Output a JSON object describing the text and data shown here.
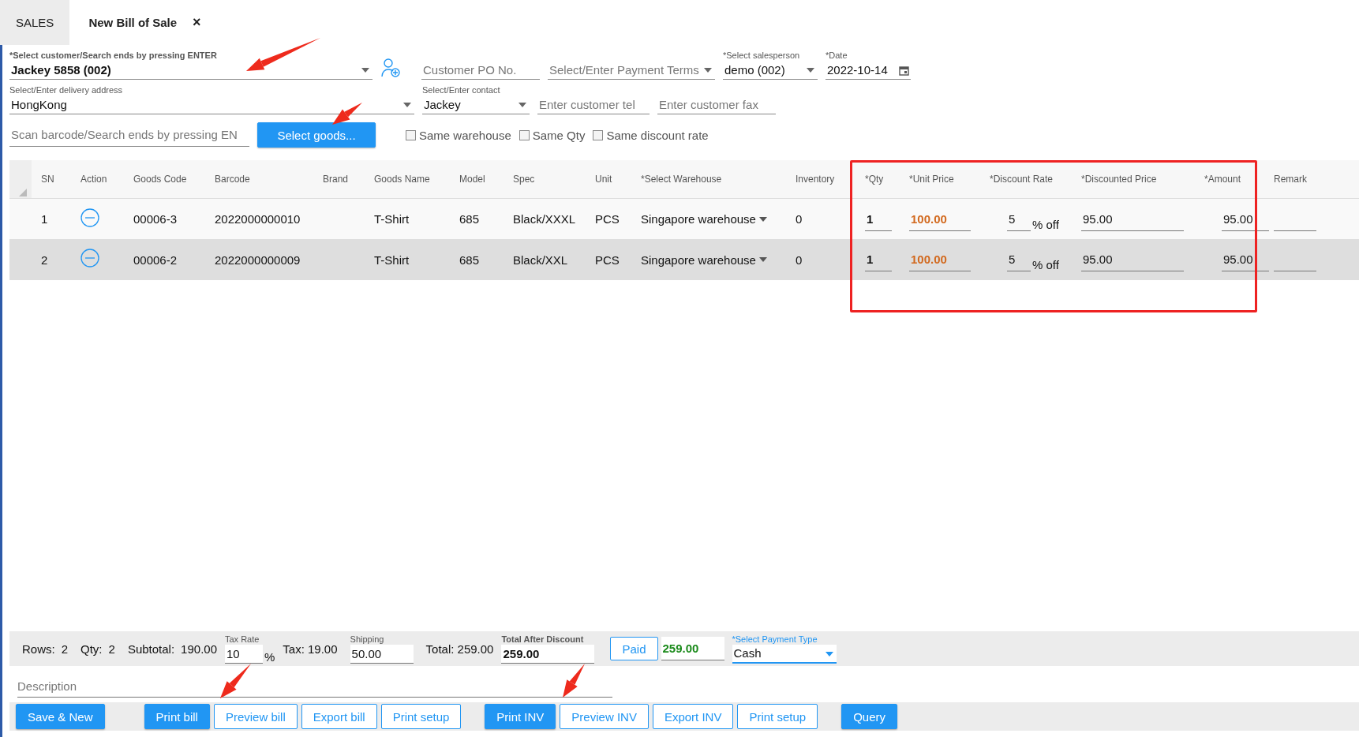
{
  "tabs": [
    {
      "label": "SALES",
      "selected": false
    },
    {
      "label": "New Bill of Sale",
      "selected": true,
      "close": "×"
    }
  ],
  "header": {
    "customer": {
      "label": "*Select customer/Search ends by pressing ENTER",
      "value": "Jackey 5858 (002)"
    },
    "po": {
      "placeholder": "Customer PO No."
    },
    "payment_terms": {
      "placeholder": "Select/Enter Payment Terms"
    },
    "salesperson": {
      "label": "*Select salesperson",
      "value": "demo (002)"
    },
    "date": {
      "label": "*Date",
      "value": "2022-10-14"
    },
    "delivery": {
      "label": "Select/Enter delivery address",
      "value": "HongKong"
    },
    "contact": {
      "label": "Select/Enter contact",
      "value": "Jackey"
    },
    "tel": {
      "placeholder": "Enter customer tel"
    },
    "fax": {
      "placeholder": "Enter customer fax"
    },
    "scan": {
      "placeholder": "Scan barcode/Search ends by pressing EN"
    },
    "select_goods": "Select goods...",
    "options": [
      {
        "label": "Same warehouse",
        "checked": false
      },
      {
        "label": "Same Qty",
        "checked": false
      },
      {
        "label": "Same discount rate",
        "checked": false
      }
    ]
  },
  "table": {
    "columns": [
      "SN",
      "Action",
      "Goods Code",
      "Barcode",
      "Brand",
      "Goods Name",
      "Model",
      "Spec",
      "Unit",
      "*Select Warehouse",
      "Inventory",
      "*Qty",
      "*Unit Price",
      "*Discount Rate",
      "*Discounted Price",
      "*Amount",
      "Remark"
    ],
    "rows": [
      {
        "sn": "1",
        "code": "00006-3",
        "barcode": "2022000000010",
        "name": "T-Shirt",
        "model": "685",
        "spec": "Black/XXXL",
        "unit": "PCS",
        "warehouse": "Singapore warehouse",
        "inventory": "0",
        "qty": "1",
        "unit_price": "100.00",
        "discount": "5",
        "discount_suffix": "% off",
        "discounted_price": "95.00",
        "amount": "95.00",
        "selected": false
      },
      {
        "sn": "2",
        "code": "00006-2",
        "barcode": "2022000000009",
        "name": "T-Shirt",
        "model": "685",
        "spec": "Black/XXL",
        "unit": "PCS",
        "warehouse": "Singapore warehouse",
        "inventory": "0",
        "qty": "1",
        "unit_price": "100.00",
        "discount": "5",
        "discount_suffix": "% off",
        "discounted_price": "95.00",
        "amount": "95.00",
        "selected": true
      }
    ]
  },
  "summary": {
    "rows": {
      "label": "Rows:",
      "value": "2"
    },
    "qty": {
      "label": "Qty:",
      "value": "2"
    },
    "subtotal": {
      "label": "Subtotal:",
      "value": "190.00"
    },
    "tax_rate": {
      "label": "Tax Rate",
      "value": "10",
      "suffix": "%"
    },
    "tax": "Tax: 19.00",
    "shipping": {
      "label": "Shipping",
      "value": "50.00"
    },
    "total": "Total: 259.00",
    "total_after": {
      "label": "Total After Discount",
      "value": "259.00"
    },
    "paid": {
      "button": "Paid",
      "value": "259.00"
    },
    "payment_type": {
      "label": "*Select Payment Type",
      "value": "Cash"
    }
  },
  "description": {
    "placeholder": "Description"
  },
  "button_groups": [
    [
      {
        "label": "Save & New",
        "kind": "primary"
      }
    ],
    [
      {
        "label": "Print bill",
        "kind": "primary"
      },
      {
        "label": "Preview bill",
        "kind": "outline"
      },
      {
        "label": "Export bill",
        "kind": "outline"
      },
      {
        "label": "Print setup",
        "kind": "outline"
      }
    ],
    [
      {
        "label": "Print INV",
        "kind": "primary"
      },
      {
        "label": "Preview INV",
        "kind": "outline"
      },
      {
        "label": "Export INV",
        "kind": "outline"
      },
      {
        "label": "Print setup",
        "kind": "outline"
      }
    ],
    [
      {
        "label": "Query",
        "kind": "primary"
      }
    ]
  ],
  "annotations": {
    "highlight": true
  }
}
